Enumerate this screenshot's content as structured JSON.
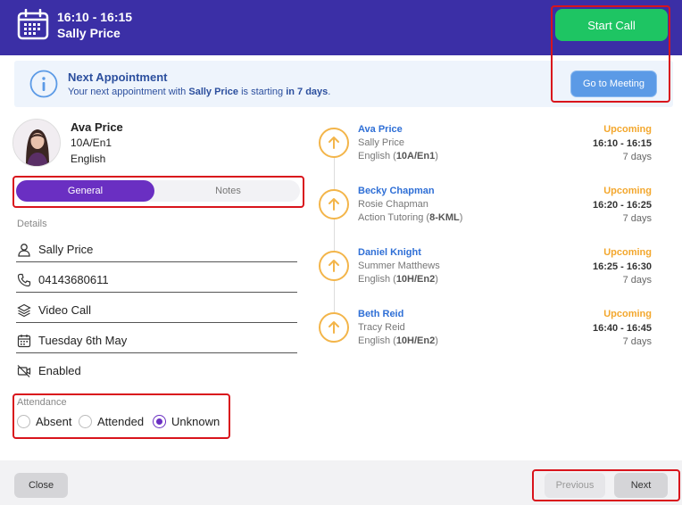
{
  "header": {
    "time": "16:10 - 16:15",
    "name": "Sally Price",
    "start_call_label": "Start Call",
    "accent_color": "#3b2fa6",
    "start_call_color": "#1ec563"
  },
  "banner": {
    "title": "Next Appointment",
    "msg_prefix": "Your next appointment with ",
    "msg_name": "Sally Price",
    "msg_mid": " is starting ",
    "msg_when": "in 7 days",
    "msg_end": ".",
    "goto_label": "Go to Meeting"
  },
  "student": {
    "name": "Ava Price",
    "class": "10A/En1",
    "subject": "English"
  },
  "tabs": {
    "general": "General",
    "notes": "Notes",
    "active": "General"
  },
  "details": {
    "label": "Details",
    "teacher": "Sally Price",
    "phone": "04143680611",
    "type": "Video Call",
    "date": "Tuesday 6th May",
    "camera": "Enabled"
  },
  "attendance": {
    "label": "Attendance",
    "options": [
      "Absent",
      "Attended",
      "Unknown"
    ],
    "selected": "Unknown"
  },
  "appointments": [
    {
      "student": "Ava Price",
      "teacher": "Sally Price",
      "course": "English",
      "code": "10A/En1",
      "status": "Upcoming",
      "time": "16:10 - 16:15",
      "days": "7 days"
    },
    {
      "student": "Becky Chapman",
      "teacher": "Rosie Chapman",
      "course": "Action Tutoring",
      "code": "8-KML",
      "status": "Upcoming",
      "time": "16:20 - 16:25",
      "days": "7 days"
    },
    {
      "student": "Daniel Knight",
      "teacher": "Summer Matthews",
      "course": "English",
      "code": "10H/En2",
      "status": "Upcoming",
      "time": "16:25 - 16:30",
      "days": "7 days"
    },
    {
      "student": "Beth Reid",
      "teacher": "Tracy Reid",
      "course": "English",
      "code": "10H/En2",
      "status": "Upcoming",
      "time": "16:40 - 16:45",
      "days": "7 days"
    }
  ],
  "footer": {
    "close_label": "Close",
    "previous_label": "Previous",
    "next_label": "Next"
  },
  "icons": {
    "header": "calendar-icon",
    "banner": "info-icon",
    "timeline": "arrow-up-icon",
    "details": [
      "user-icon",
      "phone-icon",
      "layers-icon",
      "calendar-icon",
      "video-off-icon"
    ]
  }
}
